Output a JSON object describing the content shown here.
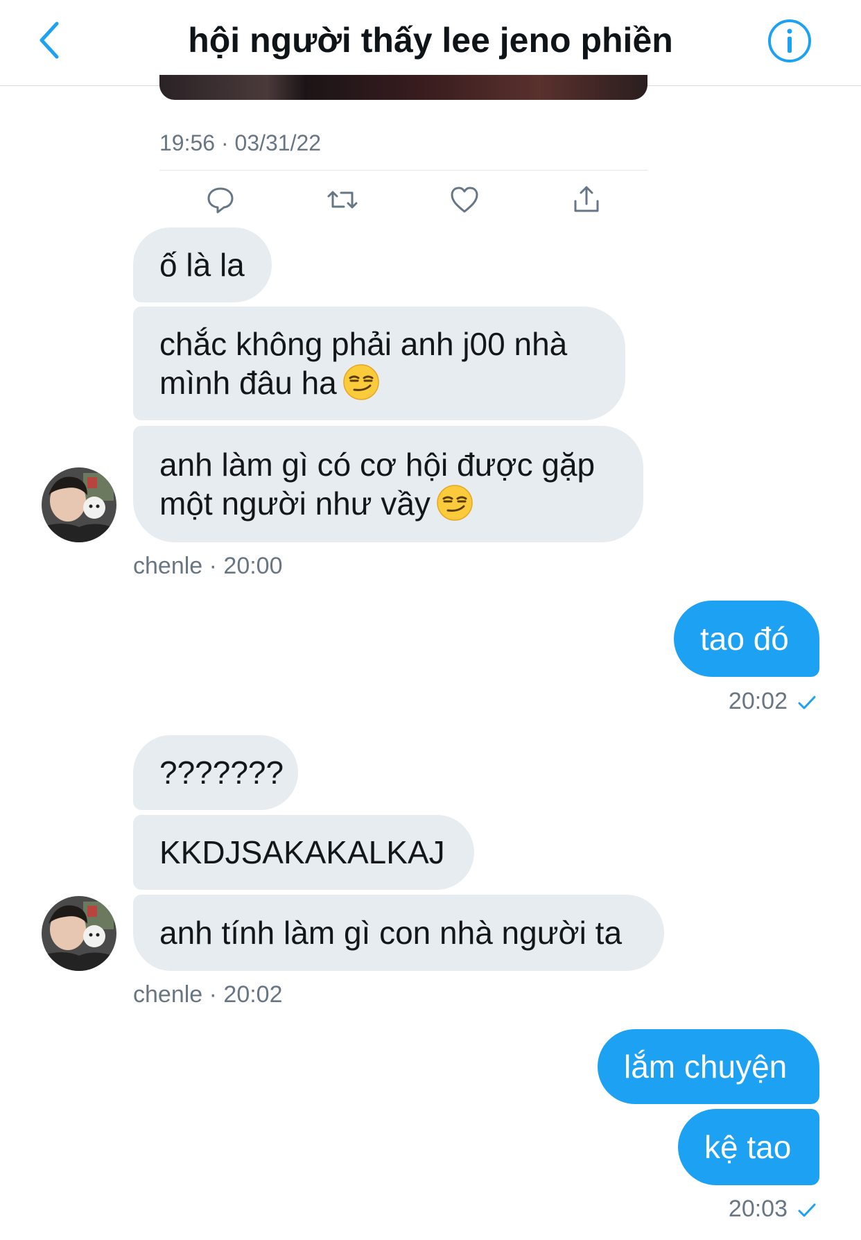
{
  "header": {
    "title": "hội người thấy lee jeno phiền",
    "back_icon": "chevron-left-icon",
    "info_icon": "info-circle-icon"
  },
  "tweet": {
    "timestamp": "19:56 · 03/31/22",
    "actions": [
      "reply-icon",
      "retweet-icon",
      "like-icon",
      "share-icon"
    ]
  },
  "messages": {
    "g1": {
      "m1": "ố là la",
      "m2_line1": "chắc không phải anh j00 nhà",
      "m2_line2": "mình đâu ha",
      "m3_line1": "anh làm gì có cơ hội được gặp",
      "m3_line2": "một người như vầy",
      "meta": "chenle · 20:00"
    },
    "out1": {
      "text": "tao đó",
      "meta": "20:02"
    },
    "g2": {
      "m1": "???????",
      "m2": "KKDJSAKAKALKAJ",
      "m3": "anh tính làm gì con nhà người ta",
      "meta": "chenle · 20:02"
    },
    "out2": {
      "m1": "lắm chuyện",
      "m2": "kệ tao",
      "meta": "20:03"
    }
  },
  "colors": {
    "accent": "#1da1f2",
    "incoming_bubble": "#e6ecf0",
    "meta_text": "#687684"
  }
}
